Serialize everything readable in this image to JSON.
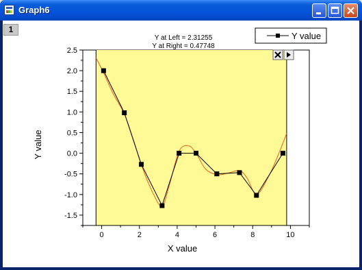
{
  "window": {
    "title": "Graph6"
  },
  "layer": {
    "label": "1"
  },
  "cursor": {
    "left_label": "Y at Left = 2.31255",
    "right_label": "Y at Right = 0.47748"
  },
  "legend": {
    "label": "Y value"
  },
  "chart_data": {
    "type": "line",
    "title": "",
    "xlabel": "X value",
    "ylabel": "Y value",
    "xlim": [
      -1,
      11
    ],
    "ylim": [
      -1.75,
      2.5
    ],
    "x_ticks": [
      0,
      2,
      4,
      6,
      8,
      10
    ],
    "y_ticks": [
      -1.5,
      -1.0,
      -0.5,
      0.0,
      0.5,
      1.0,
      1.5,
      2.0,
      2.5
    ],
    "x_tick_labels": [
      "0",
      "2",
      "4",
      "6",
      "8",
      "10"
    ],
    "y_tick_labels": [
      "-1.5",
      "-1.0",
      "-0.5",
      "0.0",
      "0.5",
      "1.0",
      "1.5",
      "2.0",
      "2.5"
    ],
    "highlight_range": [
      -0.3,
      9.8
    ],
    "series": [
      {
        "name": "Y value",
        "x": [
          0.1,
          1.2,
          2.1,
          3.2,
          4.1,
          5.0,
          6.1,
          7.3,
          8.2,
          9.6
        ],
        "y": [
          2.0,
          0.98,
          -0.27,
          -1.27,
          0.0,
          0.0,
          -0.5,
          -0.47,
          -1.02,
          0.0
        ]
      }
    ],
    "fit_curve": {
      "x": [
        -0.3,
        0.1,
        0.6,
        1.2,
        1.7,
        2.1,
        2.7,
        3.2,
        3.6,
        4.1,
        4.6,
        5.0,
        5.5,
        6.1,
        6.7,
        7.3,
        7.7,
        8.2,
        8.8,
        9.3,
        9.8
      ],
      "y": [
        2.31,
        1.95,
        1.45,
        0.95,
        0.3,
        -0.28,
        -0.95,
        -1.28,
        -0.75,
        0.05,
        0.18,
        0.0,
        -0.38,
        -0.52,
        -0.48,
        -0.42,
        -0.6,
        -1.0,
        -0.6,
        -0.1,
        0.48
      ]
    },
    "colors": {
      "line": "#000000",
      "fit": "#E8601C",
      "highlight": "#FFFA96",
      "marker": "#000000"
    }
  }
}
